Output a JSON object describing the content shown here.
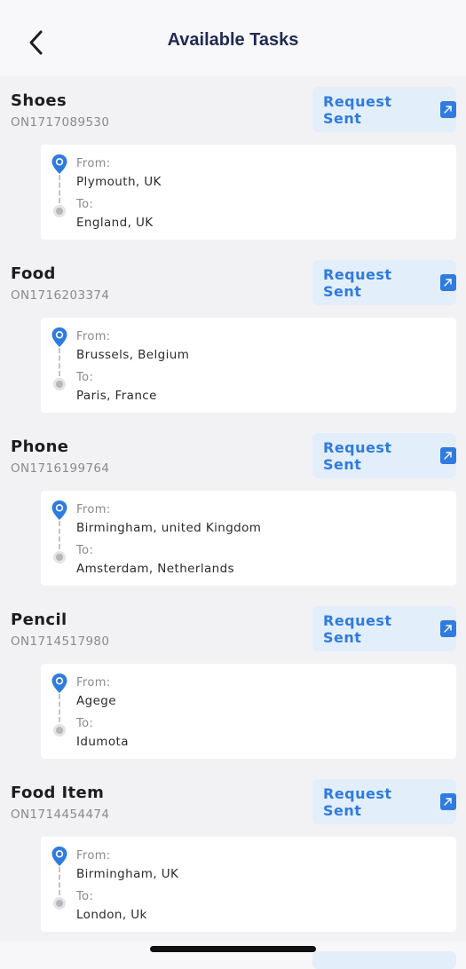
{
  "header": {
    "title": "Available Tasks"
  },
  "labels": {
    "from": "From:",
    "to": "To:"
  },
  "tasks": [
    {
      "name": "Shoes",
      "id": "ON1717089530",
      "button_label": "Request Sent",
      "from": "Plymouth, UK",
      "to": "England, UK"
    },
    {
      "name": "Food",
      "id": "ON1716203374",
      "button_label": "Request Sent",
      "from": "Brussels, Belgium",
      "to": "Paris, France"
    },
    {
      "name": "Phone",
      "id": "ON1716199764",
      "button_label": "Request Sent",
      "from": "Birmingham, united Kingdom",
      "to": "Amsterdam, Netherlands"
    },
    {
      "name": "Pencil",
      "id": "ON1714517980",
      "button_label": "Request Sent",
      "from": "Agege",
      "to": "Idumota"
    },
    {
      "name": "Food Item",
      "id": "ON1714454474",
      "button_label": "Request Sent",
      "from": "Birmingham, UK",
      "to": "London, Uk"
    }
  ],
  "colors": {
    "accent": "#2f7be0",
    "title": "#1f2a55",
    "button_bg": "#e3eefb"
  },
  "icons": {
    "back": "chevron-left-icon",
    "external": "external-link-icon",
    "origin": "location-pin-icon",
    "destination": "destination-dot-icon"
  }
}
